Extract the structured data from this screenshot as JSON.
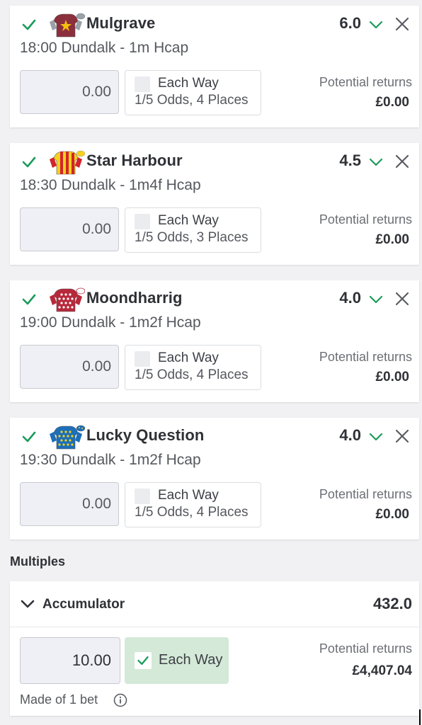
{
  "selections": [
    {
      "horse": "Mulgrave",
      "odds": "6.0",
      "race": "18:00 Dundalk - 1m Hcap",
      "stake": "0.00",
      "each_way_label": "Each Way",
      "each_way_terms": "1/5 Odds, 4 Places",
      "returns_label": "Potential returns",
      "returns_value": "£0.00",
      "silk_colors": [
        "#8c2f3d",
        "#f4c20d"
      ],
      "cap_color": "#9aa1a8"
    },
    {
      "horse": "Star Harbour",
      "odds": "4.5",
      "race": "18:30 Dundalk - 1m4f Hcap",
      "stake": "0.00",
      "each_way_label": "Each Way",
      "each_way_terms": "1/5 Odds, 3 Places",
      "returns_label": "Potential returns",
      "returns_value": "£0.00",
      "silk_colors": [
        "#f4d21d",
        "#d4232b"
      ],
      "cap_color": "#f4d21d"
    },
    {
      "horse": "Moondharrig",
      "odds": "4.0",
      "race": "19:00 Dundalk - 1m2f Hcap",
      "stake": "0.00",
      "each_way_label": "Each Way",
      "each_way_terms": "1/5 Odds, 4 Places",
      "returns_label": "Potential returns",
      "returns_value": "£0.00",
      "silk_colors": [
        "#b8283b",
        "#ffffff"
      ],
      "cap_color": "#ffffff"
    },
    {
      "horse": "Lucky Question",
      "odds": "4.0",
      "race": "19:30 Dundalk - 1m2f Hcap",
      "stake": "0.00",
      "each_way_label": "Each Way",
      "each_way_terms": "1/5 Odds, 4 Places",
      "returns_label": "Potential returns",
      "returns_value": "£0.00",
      "silk_colors": [
        "#1c6fb8",
        "#f4d21d"
      ],
      "cap_color": "#1c6fb8"
    }
  ],
  "multiples": {
    "heading": "Multiples",
    "accumulator": {
      "title": "Accumulator",
      "odds": "432.0",
      "stake": "10.00",
      "each_way_label": "Each Way",
      "each_way_checked": true,
      "returns_label": "Potential returns",
      "returns_value": "£4,407.04",
      "made_of": "Made of 1 bet"
    }
  },
  "colors": {
    "check_green": "#1a9b5a",
    "each_way_active_bg": "#d4e9d8"
  },
  "icons": {
    "checkbox": "check-icon",
    "odds_toggle": "chevron-down-icon",
    "remove": "close-icon",
    "info": "info-icon"
  }
}
